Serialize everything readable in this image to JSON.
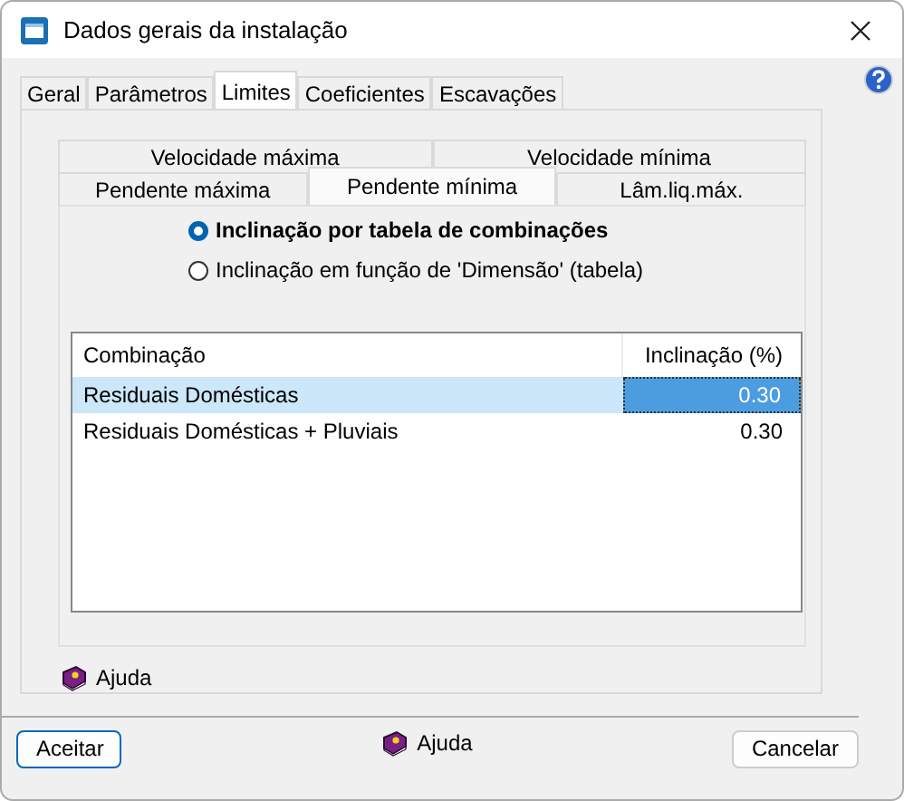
{
  "window": {
    "title": "Dados gerais da instalação"
  },
  "tabs": [
    {
      "label": "Geral",
      "selected": false
    },
    {
      "label": "Parâmetros",
      "selected": false
    },
    {
      "label": "Limites",
      "selected": true
    },
    {
      "label": "Coeficientes",
      "selected": false
    },
    {
      "label": "Escavações",
      "selected": false
    }
  ],
  "subtab_rows": [
    [
      {
        "label": "Velocidade máxima",
        "selected": false
      },
      {
        "label": "Velocidade mínima",
        "selected": false
      }
    ],
    [
      {
        "label": "Pendente máxima",
        "selected": false
      },
      {
        "label": "Pendente mínima",
        "selected": true
      },
      {
        "label": "Lâm.liq.máx.",
        "selected": false
      }
    ]
  ],
  "options": [
    {
      "label": "Inclinação por tabela de combinações",
      "selected": true
    },
    {
      "label": "Inclinação em função de 'Dimensão' (tabela)",
      "selected": false
    }
  ],
  "table": {
    "columns": [
      "Combinação",
      "Inclinação (%)"
    ],
    "rows": [
      {
        "cells": [
          "Residuais Domésticas",
          "0.30"
        ],
        "selected": true
      },
      {
        "cells": [
          "Residuais Domésticas + Pluviais",
          "0.30"
        ],
        "selected": false
      }
    ]
  },
  "panel_help": "Ajuda",
  "buttons": {
    "accept": "Aceitar",
    "help": "Ajuda",
    "cancel": "Cancelar"
  }
}
